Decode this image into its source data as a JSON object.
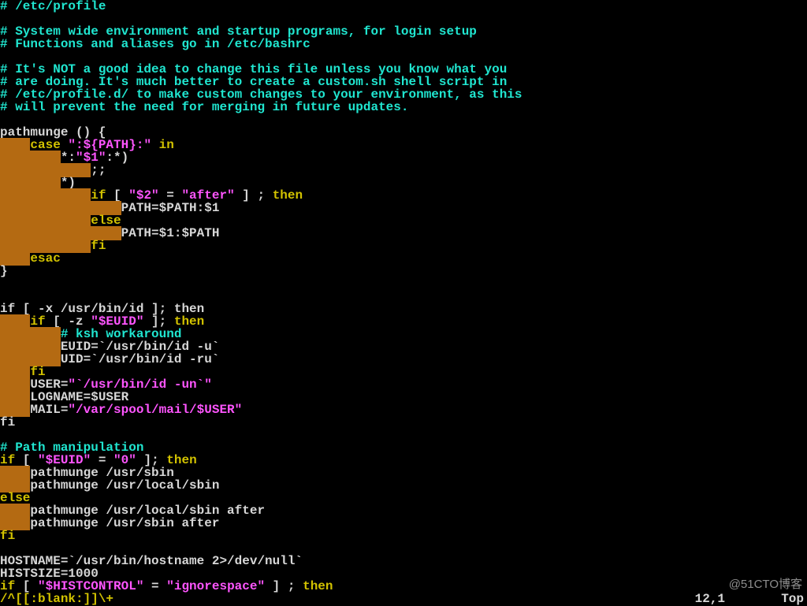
{
  "file": {
    "header_line": "# /etc/profile",
    "comment1": "# System wide environment and startup programs, for login setup",
    "comment2": "# Functions and aliases go in /etc/bashrc",
    "comment3": "# It's NOT a good idea to change this file unless you know what you",
    "comment4": "# are doing. It's much better to create a custom.sh shell script in",
    "comment5": "# /etc/profile.d/ to make custom changes to your environment, as this",
    "comment6": "# will prevent the need for merging in future updates."
  },
  "func": {
    "def": "pathmunge () {",
    "case_kw": "case",
    "case_pat": "\":${PATH}:\"",
    "in_kw": " in",
    "pat1a": "*:",
    "pat1b": "\"$1\"",
    "pat1c": ":*)",
    "pat1_body": ";;",
    "pat2": "*)",
    "if_kw": "if",
    "if_cond_a": " [ ",
    "if_str1": "\"$2\"",
    "if_eq": " = ",
    "if_str2": "\"after\"",
    "if_cond_b": " ] ; ",
    "then_kw": "then",
    "then_body": "PATH=$PATH:$1",
    "else_kw": "else",
    "else_body": "PATH=$1:$PATH",
    "fi_kw": "fi",
    "esac_kw": "esac",
    "close": "}"
  },
  "idblock": {
    "l1": "if [ -x /usr/bin/id ]; then",
    "l2a": "if",
    "l2b": " [ -z ",
    "l2c": "\"$EUID\"",
    "l2d": " ]; ",
    "l2e": "then",
    "l3": "# ksh workaround",
    "l4": "EUID=`/usr/bin/id -u`",
    "l5": "UID=`/usr/bin/id -ru`",
    "l6": "fi",
    "l7a": "USER=",
    "l7b": "\"`/usr/bin/id -un`\"",
    "l8": "LOGNAME=$USER",
    "l9a": "MAIL=",
    "l9b": "\"/var/spool/mail/$USER\"",
    "l10": "fi"
  },
  "pathmanip": {
    "title": "# Path manipulation",
    "l1a": "if",
    "l1b": " [ ",
    "l1c": "\"$EUID\"",
    "l1d": " = ",
    "l1e": "\"0\"",
    "l1f": " ]; ",
    "l1g": "then",
    "l2": "pathmunge /usr/sbin",
    "l3": "pathmunge /usr/local/sbin",
    "l4": "else",
    "l5": "pathmunge /usr/local/sbin after",
    "l6": "pathmunge /usr/sbin after",
    "l7": "fi"
  },
  "tail": {
    "l1": "HOSTNAME=`/usr/bin/hostname 2>/dev/null`",
    "l2": "HISTSIZE=1000",
    "l3a": "if",
    "l3b": " [ ",
    "l3c": "\"$HISTCONTROL\"",
    "l3d": " = ",
    "l3e": "\"ignorespace\"",
    "l3f": " ] ; ",
    "l3g": "then"
  },
  "search_pattern": "/^[[:blank:]]\\+",
  "status": {
    "pos": "12,1",
    "loc": "Top"
  },
  "watermark": "@51CTO博客"
}
